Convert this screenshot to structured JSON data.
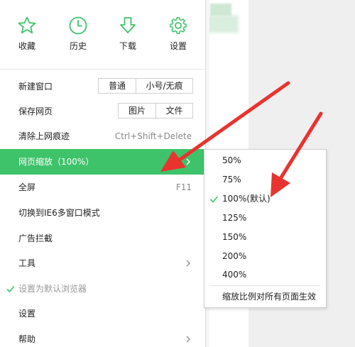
{
  "toolbar": {
    "items": [
      {
        "label": "收藏",
        "icon": "star-icon"
      },
      {
        "label": "历史",
        "icon": "clock-icon"
      },
      {
        "label": "下载",
        "icon": "download-arrow-icon"
      },
      {
        "label": "设置",
        "icon": "gear-icon"
      }
    ]
  },
  "menu": {
    "new_window": {
      "label": "新建窗口",
      "btn_normal": "普通",
      "btn_small": "小号/无痕"
    },
    "save_page": {
      "label": "保存网页",
      "btn_image": "图片",
      "btn_file": "文件"
    },
    "clear_history": {
      "label": "清除上网痕迹",
      "shortcut": "Ctrl+Shift+Delete"
    },
    "zoom": {
      "label": "网页缩放（100%）"
    },
    "fullscreen": {
      "label": "全屏",
      "shortcut": "F11"
    },
    "ie6_mode": {
      "label": "切换到IE6多窗口模式"
    },
    "adblock": {
      "label": "广告拦截"
    },
    "tools": {
      "label": "工具"
    },
    "default_browser": {
      "label": "设置为默认浏览器"
    },
    "settings": {
      "label": "设置"
    },
    "help": {
      "label": "帮助"
    }
  },
  "zoom_submenu": {
    "options": [
      "50%",
      "75%",
      "100%(默认)",
      "125%",
      "150%",
      "200%",
      "400%"
    ],
    "selected": "100%(默认)",
    "apply_all": "缩放比例对所有页面生效"
  },
  "colors": {
    "accent_green": "#3ec36a",
    "arrow_red": "#e8332f",
    "menu_text": "#222222",
    "muted_text": "#999999"
  }
}
